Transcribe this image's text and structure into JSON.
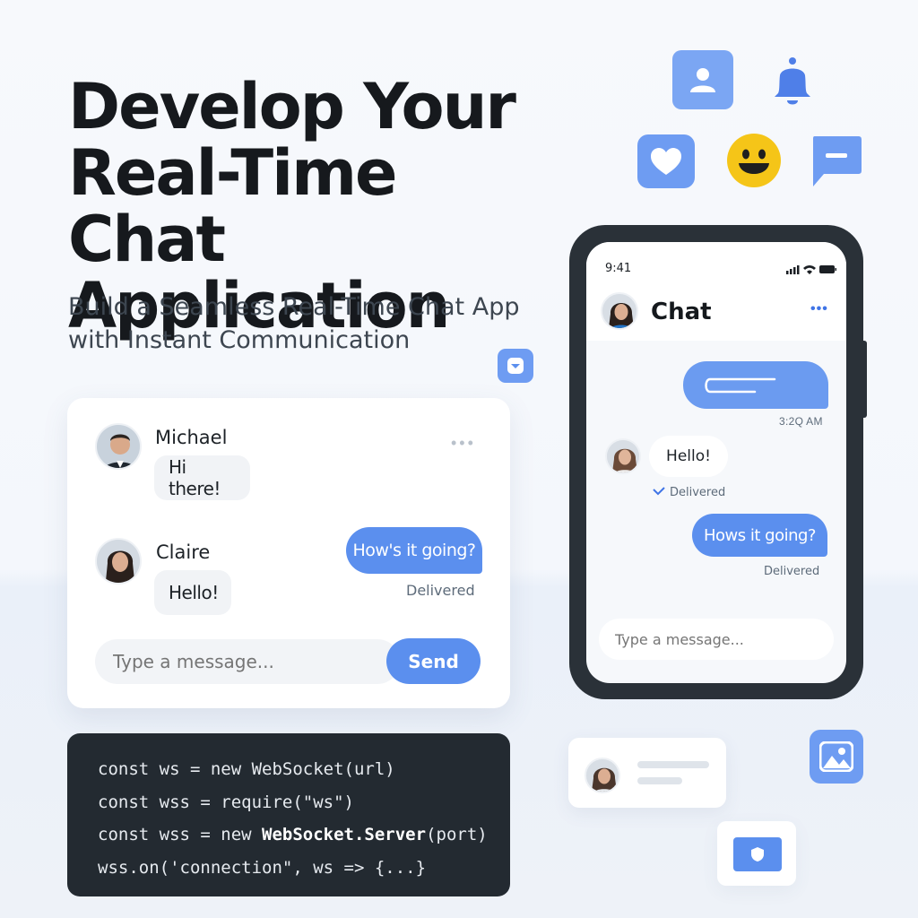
{
  "hero": {
    "title_line1": "Develop Your",
    "title_line2": "Real-Time Chat",
    "title_line3": "Application",
    "subtitle_line1": "Build a Seamless Real-Time Chat App",
    "subtitle_line2": "with Instant Communication"
  },
  "floating_icons": [
    "user-icon",
    "bell-icon",
    "heart-icon",
    "smiley-icon",
    "message-icon",
    "download-icon",
    "image-icon",
    "shield-icon"
  ],
  "chat_card": {
    "messages": [
      {
        "sender": "Michael",
        "text": "Hi there!"
      },
      {
        "sender": "Claire",
        "text": "Hello!"
      }
    ],
    "outgoing": {
      "text": "How's it going?",
      "status": "Delivered"
    },
    "input_placeholder": "Type a message...",
    "send_label": "Send"
  },
  "code": {
    "line1_a": "const ws = new WebSocket(url)",
    "line2": "const wss = require(\"ws\")",
    "line3_a": "const wss = new ",
    "line3_b": "WebSocket.Server",
    "line3_c": "(port)",
    "line4": "wss.on('connection\", ws => {...}"
  },
  "phone": {
    "time": "9:41",
    "title": "Chat",
    "sent_time": "3:2Q AM",
    "incoming_text": "Hello!",
    "incoming_status": "Delivered",
    "outgoing_text": "Hows it going?",
    "outgoing_status": "Delivered",
    "input_placeholder": "Type a message..."
  },
  "colors": {
    "accent": "#5b8fee",
    "dark": "#232a31",
    "smiley": "#f5c518"
  }
}
